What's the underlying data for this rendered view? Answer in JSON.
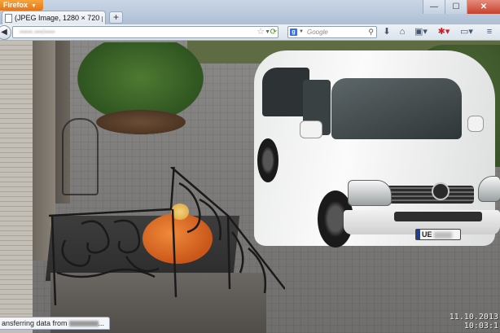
{
  "browser": {
    "app_menu_label": "Firefox",
    "tab": {
      "title": "(JPEG Image, 1280 × 720 pixels) - Scaled ..."
    },
    "new_tab_label": "+",
    "window_controls": {
      "minimize": "—",
      "maximize": "☐",
      "close": "✕"
    }
  },
  "navbar": {
    "url": "▪▪▪▪▪.▪▪▪/▪▪▪▪",
    "search_engine_letter": "g",
    "search_placeholder": "Google"
  },
  "image": {
    "plate": {
      "prefix": "UE"
    },
    "timestamp_date": "11.10.2013",
    "timestamp_time": "10:03:1"
  },
  "statusbar": {
    "text": "ansferring data from"
  },
  "icons": [
    "back-icon",
    "star-icon",
    "reload-icon",
    "search-icon",
    "download-icon",
    "home-icon",
    "bookmarks-icon",
    "addon-icon",
    "sync-icon",
    "menu-icon"
  ]
}
